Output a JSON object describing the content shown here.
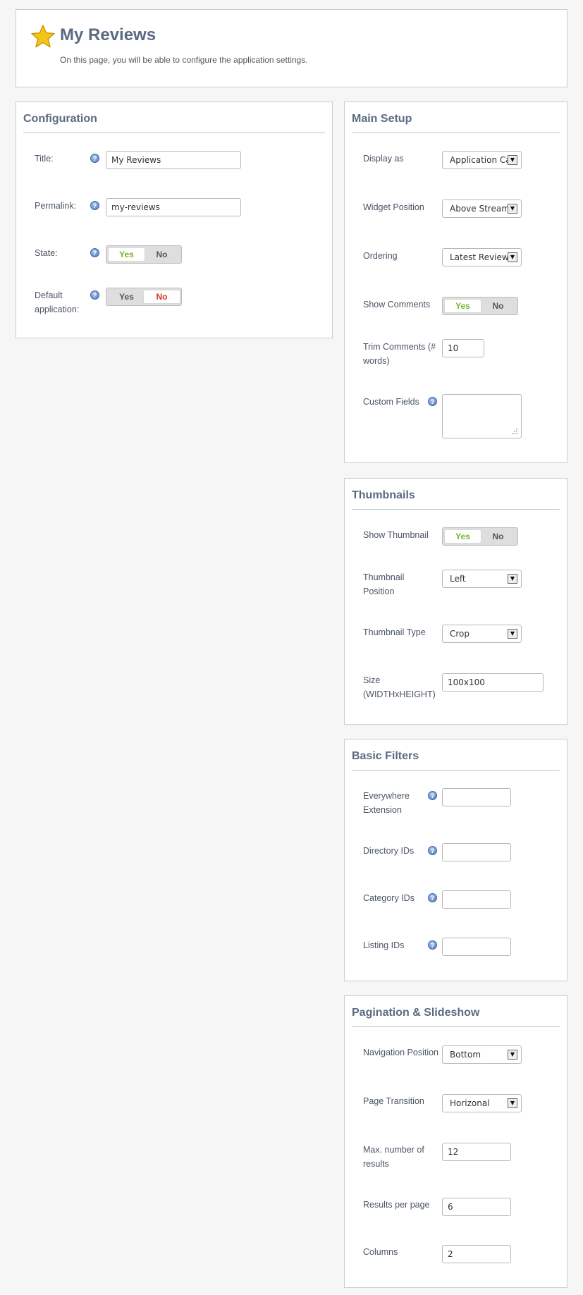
{
  "header": {
    "title": "My Reviews",
    "description": "On this page, you will be able to configure the application settings."
  },
  "configuration": {
    "heading": "Configuration",
    "title_label": "Title:",
    "title_value": "My Reviews",
    "permalink_label": "Permalink:",
    "permalink_value": "my-reviews",
    "state_label": "State:",
    "state_value": "Yes",
    "default_label": "Default application:",
    "default_value": "No",
    "yes": "Yes",
    "no": "No"
  },
  "main_setup": {
    "heading": "Main Setup",
    "display_label": "Display as",
    "display_value": "Application Ca",
    "widget_label": "Widget Position",
    "widget_value": "Above Stream",
    "ordering_label": "Ordering",
    "ordering_value": "Latest Reviews",
    "comments_label": "Show Comments",
    "comments_value": "Yes",
    "trim_label": "Trim Comments (# words)",
    "trim_value": "10",
    "custom_label": "Custom Fields",
    "yes": "Yes",
    "no": "No"
  },
  "thumbnails": {
    "heading": "Thumbnails",
    "show_label": "Show Thumbnail",
    "show_value": "Yes",
    "position_label": "Thumbnail Position",
    "position_value": "Left",
    "type_label": "Thumbnail Type",
    "type_value": "Crop",
    "size_label": "Size (WIDTHxHEIGHT)",
    "size_value": "100x100",
    "yes": "Yes",
    "no": "No"
  },
  "basic_filters": {
    "heading": "Basic Filters",
    "everywhere_label": "Everywhere Extension",
    "directory_label": "Directory IDs",
    "category_label": "Category IDs",
    "listing_label": "Listing IDs"
  },
  "pagination": {
    "heading": "Pagination & Slideshow",
    "nav_label": "Navigation Position",
    "nav_value": "Bottom",
    "transition_label": "Page Transition",
    "transition_value": "Horizonal",
    "max_label": "Max. number of results",
    "max_value": "12",
    "per_page_label": "Results per page",
    "per_page_value": "6",
    "columns_label": "Columns",
    "columns_value": "2"
  },
  "icons": {
    "star": "star-icon",
    "help": "help-icon",
    "dropdown": "dropdown-arrow-icon"
  },
  "colors": {
    "accent_yes": "#7ab226",
    "accent_no": "#cc3322",
    "heading": "#5a6a82"
  }
}
